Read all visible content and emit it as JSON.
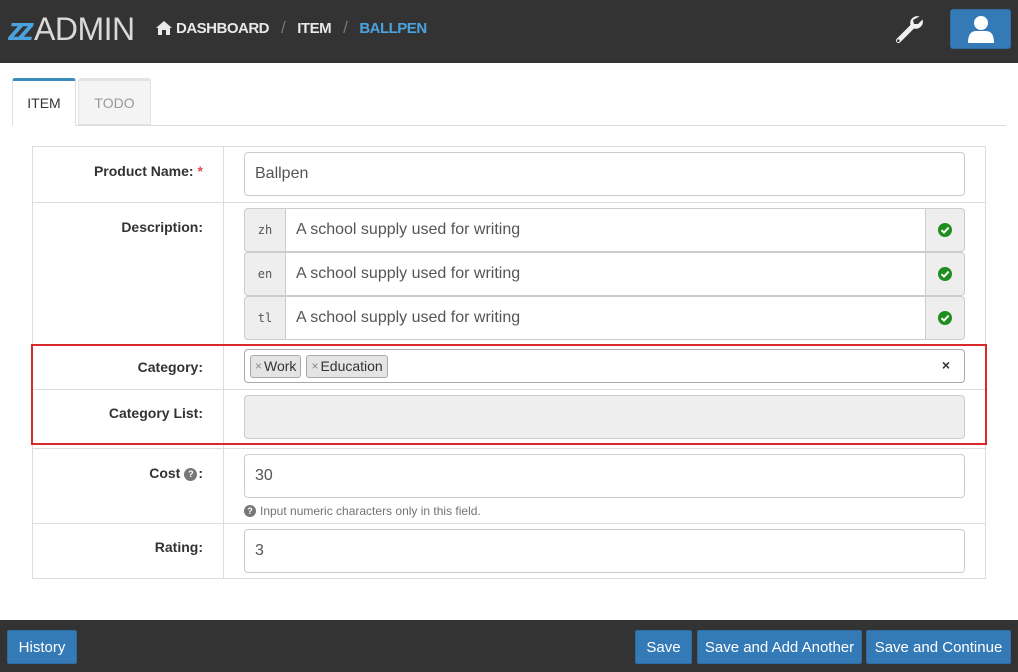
{
  "app": {
    "logo_mark": "z",
    "logo_text": "ADMIN"
  },
  "breadcrumb": [
    {
      "label": "DASHBOARD",
      "icon": "home-icon"
    },
    {
      "label": "ITEM"
    },
    {
      "label": "BALLPEN"
    }
  ],
  "header": {
    "tools_icon": "wrench-icon",
    "user_icon": "user-icon"
  },
  "tabs": [
    {
      "label": "ITEM",
      "active": true
    },
    {
      "label": "TODO",
      "active": false
    }
  ],
  "form": {
    "product_name": {
      "label": "Product Name:",
      "required_mark": "*",
      "value": "Ballpen"
    },
    "description": {
      "label": "Description:",
      "entries": [
        {
          "lang": "zh",
          "value": "A school supply used for writing",
          "status_icon": "check-circle-icon"
        },
        {
          "lang": "en",
          "value": "A school supply used for writing",
          "status_icon": "check-circle-icon"
        },
        {
          "lang": "tl",
          "value": "A school supply used for writing",
          "status_icon": "check-circle-icon"
        }
      ]
    },
    "category": {
      "label": "Category:",
      "tags": [
        {
          "remove": "×",
          "label": "Work"
        },
        {
          "remove": "×",
          "label": "Education"
        }
      ],
      "clear": "×"
    },
    "category_list": {
      "label": "Category List:",
      "value": ""
    },
    "cost": {
      "label": "Cost",
      "label_suffix": ":",
      "help_icon": "question-circle-icon",
      "value": "30",
      "help_text": "Input numeric characters only in this field."
    },
    "rating": {
      "label": "Rating:",
      "value": "3"
    }
  },
  "footer": {
    "history": "History",
    "save": "Save",
    "save_add": "Save and Add Another",
    "save_continue": "Save and Continue"
  },
  "colors": {
    "accent": "#337ab7",
    "breadcrumb_active": "#4aa3df",
    "highlight": "#d9292b",
    "success": "#1e8f1e"
  }
}
